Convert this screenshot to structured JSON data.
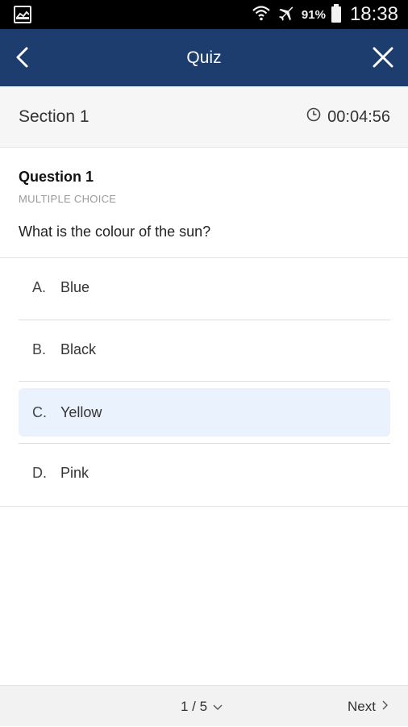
{
  "status_bar": {
    "battery_percent": "91%",
    "time": "18:38",
    "icons": [
      "gallery-icon",
      "wifi-icon",
      "airplane-icon",
      "battery-icon"
    ]
  },
  "app_bar": {
    "title": "Quiz",
    "background": "#1c3d6e",
    "icons": [
      "back-icon",
      "close-icon"
    ]
  },
  "section": {
    "name": "Section 1",
    "timer": "00:04:56"
  },
  "question": {
    "title": "Question 1",
    "type": "MULTIPLE CHOICE",
    "text": "What is the colour of the sun?"
  },
  "options": [
    {
      "letter": "A.",
      "text": "Blue",
      "selected": false
    },
    {
      "letter": "B.",
      "text": "Black",
      "selected": false
    },
    {
      "letter": "C.",
      "text": "Yellow",
      "selected": true
    },
    {
      "letter": "D.",
      "text": "Pink",
      "selected": false
    }
  ],
  "footer": {
    "pager": "1 / 5",
    "next_label": "Next"
  },
  "colors": {
    "accent": "#1c3d6e",
    "selected_bg": "#eaf3fd"
  }
}
